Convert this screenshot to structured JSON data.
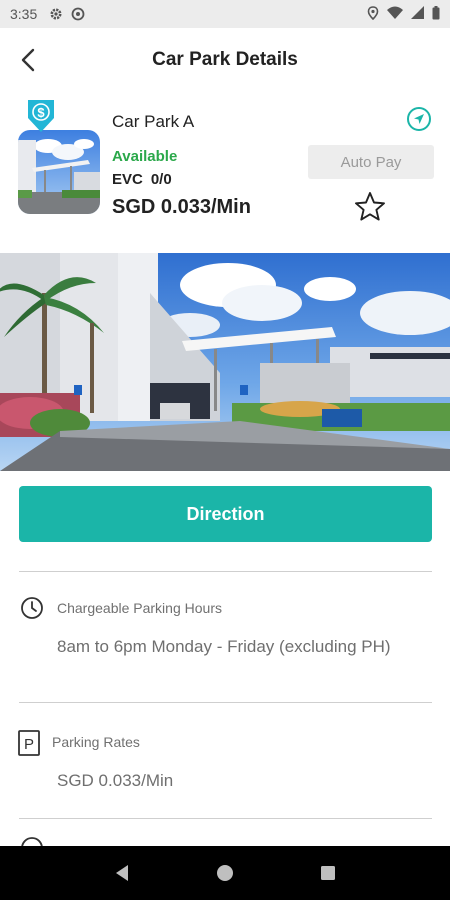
{
  "status_bar": {
    "time": "3:35",
    "icons_left": [
      "gear-icon",
      "at-sign-icon"
    ],
    "icons_right": [
      "location-icon",
      "wifi-icon",
      "signal-icon",
      "battery-icon"
    ]
  },
  "header": {
    "title": "Car Park Details",
    "back_icon": "chevron-left-icon"
  },
  "car_park": {
    "name": "Car Park A",
    "availability": "Available",
    "evc_label": "EVC",
    "evc_value": "0/0",
    "rate": "SGD 0.033/Min",
    "auto_pay_label": "Auto Pay",
    "badge_symbol": "$"
  },
  "actions": {
    "direction_label": "Direction"
  },
  "sections": [
    {
      "icon": "clock-icon",
      "title": "Chargeable Parking Hours",
      "body": "8am to 6pm Monday - Friday (excluding PH)"
    },
    {
      "icon": "parking-icon",
      "icon_letter": "P",
      "title": "Parking Rates",
      "body": "SGD 0.033/Min"
    }
  ],
  "colors": {
    "accent": "#1bb5a8",
    "available": "#2aa84a",
    "status_bar": "#ececec",
    "nav_bar": "#000000"
  }
}
